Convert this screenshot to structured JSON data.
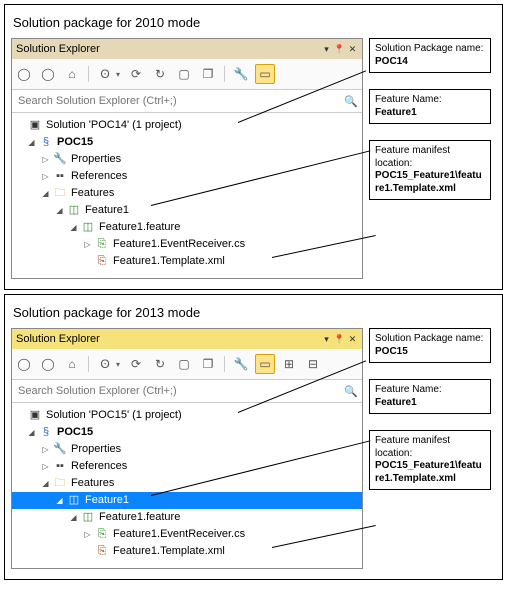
{
  "panels": [
    {
      "title": "Solution package for 2010 mode",
      "titlebar_style": "classic",
      "explorer": {
        "window_title": "Solution Explorer",
        "search_placeholder": "Search Solution Explorer (Ctrl+;)",
        "solution_label": "Solution 'POC14' (1 project)",
        "project": "POC15",
        "nodes": {
          "properties": "Properties",
          "references": "References",
          "features": "Features",
          "feature1": "Feature1",
          "feature_file": "Feature1.feature",
          "cs_file": "Feature1.EventReceiver.cs",
          "xml_file": "Feature1.Template.xml"
        },
        "selected": null
      },
      "callouts": [
        {
          "h": "Solution Package name:",
          "v": "POC14"
        },
        {
          "h": "Feature Name:",
          "v": "Feature1"
        },
        {
          "h": "Feature manifest location:",
          "v": "POC15_Feature1\\feature1.Template.xml"
        }
      ]
    },
    {
      "title": "Solution package for 2013 mode",
      "titlebar_style": "alt",
      "explorer": {
        "window_title": "Solution Explorer",
        "search_placeholder": "Search Solution Explorer (Ctrl+;)",
        "solution_label": "Solution 'POC15' (1 project)",
        "project": "POC15",
        "nodes": {
          "properties": "Properties",
          "references": "References",
          "features": "Features",
          "feature1": "Feature1",
          "feature_file": "Feature1.feature",
          "cs_file": "Feature1.EventReceiver.cs",
          "xml_file": "Feature1.Template.xml"
        },
        "selected": "feature1"
      },
      "callouts": [
        {
          "h": "Solution Package name:",
          "v": "POC15"
        },
        {
          "h": "Feature Name:",
          "v": "Feature1"
        },
        {
          "h": "Feature manifest location:",
          "v": "POC15_Feature1\\feature1.Template.xml"
        }
      ]
    }
  ]
}
